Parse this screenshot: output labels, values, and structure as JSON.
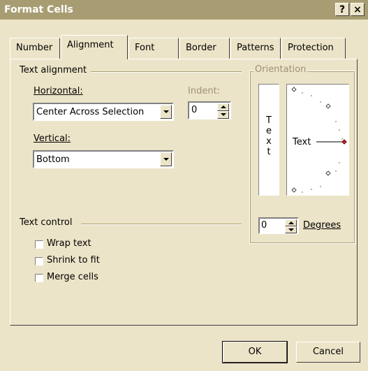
{
  "window": {
    "title": "Format Cells",
    "help_label": "?",
    "close_label": "×"
  },
  "tabs": [
    {
      "label": "Number",
      "active": false
    },
    {
      "label": "Alignment",
      "active": true
    },
    {
      "label": "Font",
      "active": false
    },
    {
      "label": "Border",
      "active": false
    },
    {
      "label": "Patterns",
      "active": false
    },
    {
      "label": "Protection",
      "active": false
    }
  ],
  "text_alignment": {
    "group_label": "Text alignment",
    "horizontal_label": "Horizontal:",
    "horizontal_value": "Center Across Selection",
    "vertical_label": "Vertical:",
    "vertical_value": "Bottom",
    "indent_label": "Indent:",
    "indent_value": "0"
  },
  "orientation": {
    "group_label": "Orientation",
    "vertical_text": [
      "T",
      "e",
      "x",
      "t"
    ],
    "dial_text": "Text",
    "degrees_value": "0",
    "degrees_label": "Degrees"
  },
  "text_control": {
    "group_label": "Text control",
    "wrap_label": "Wrap text",
    "shrink_label": "Shrink to fit",
    "merge_label": "Merge cells",
    "wrap_checked": false,
    "shrink_checked": false,
    "merge_checked": false
  },
  "buttons": {
    "ok_label": "OK",
    "cancel_label": "Cancel"
  },
  "colors": {
    "titlebar": "#a89d72",
    "dialog_bg": "#ece4c8",
    "dial_marker_active": "#d42020"
  }
}
